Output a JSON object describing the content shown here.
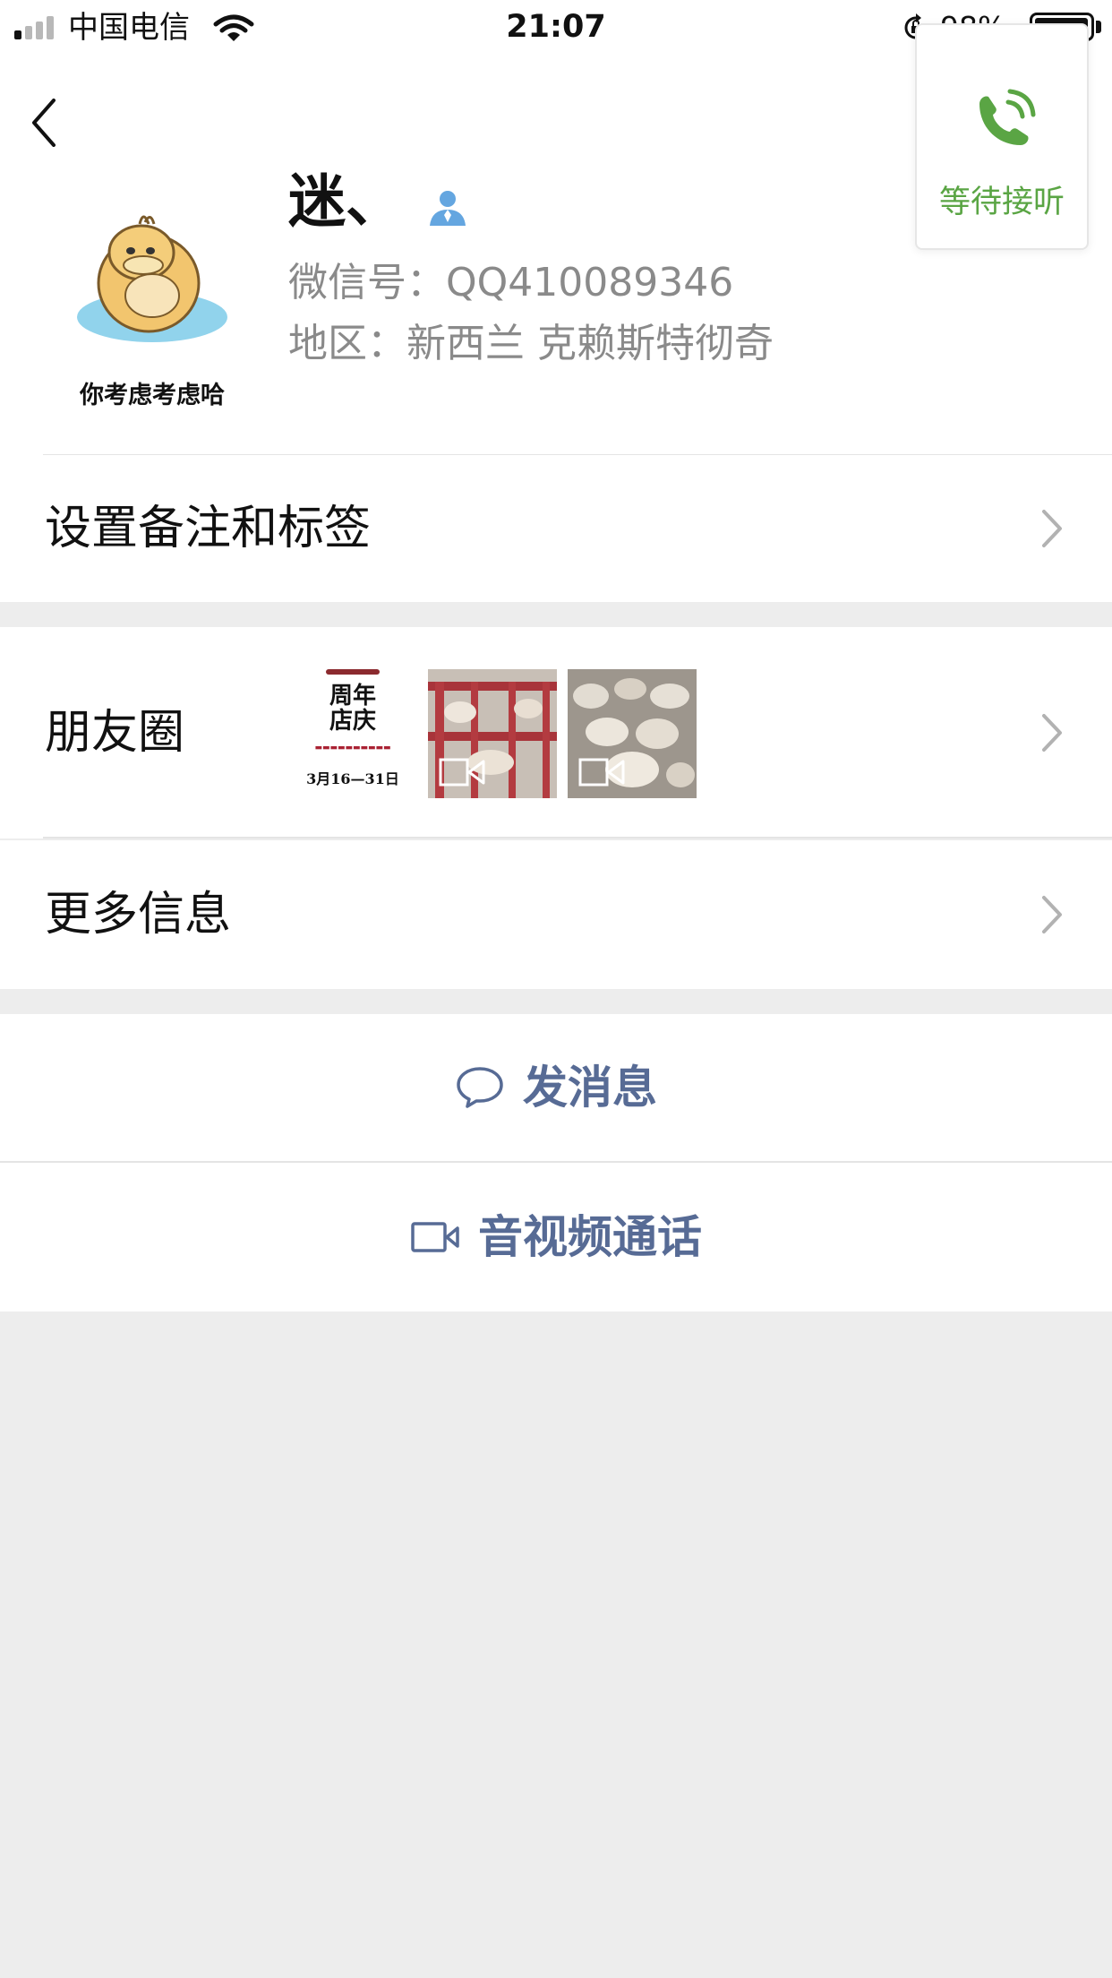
{
  "status_bar": {
    "carrier": "中国电信",
    "time": "21:07",
    "battery": "98%",
    "battery_level": 0.98,
    "signal_bars_active": 1
  },
  "header": {
    "back_icon": "chevron-left-icon"
  },
  "profile": {
    "nickname": "迷、",
    "avatar_caption": "你考虑考虑哈",
    "wechat_id_label": "微信号：",
    "wechat_id": "QQ410089346",
    "region_label": "地区：",
    "region": "新西兰 克赖斯特彻奇"
  },
  "call_card": {
    "label": "等待接听",
    "icon": "phone-icon",
    "color": "#5aa544"
  },
  "rows": {
    "remark": "设置备注和标签",
    "moments": "朋友圈",
    "more_info": "更多信息"
  },
  "moments": {
    "poster_title_line1": "周年",
    "poster_title_line2": "店庆",
    "poster_date": "3月16—31日"
  },
  "actions": {
    "send_message": "发消息",
    "av_call": "音视频通话",
    "link_color": "#576b95"
  }
}
